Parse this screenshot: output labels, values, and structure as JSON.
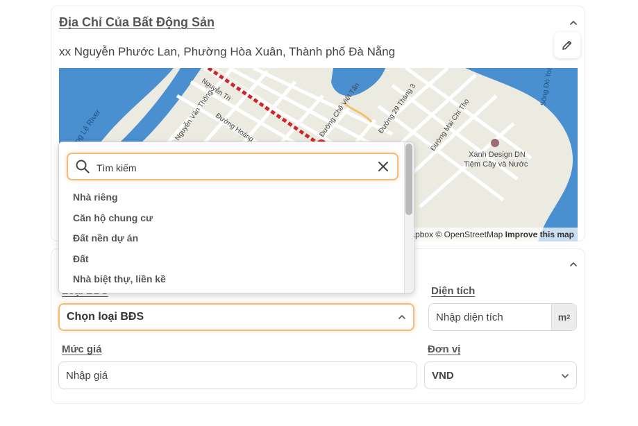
{
  "address_section": {
    "title": "Địa Chỉ Của Bất Động Sản",
    "address": "xx Nguyễn Phước Lan, Phường Hòa Xuân, Thành phố Đà Nẵng"
  },
  "map": {
    "labels": {
      "river_left": "Sông Lệ River",
      "river_right": "Sông Đò Toả",
      "street_1": "Nguyễn Văn Thông",
      "street_2": "Đường Hoàng",
      "street_3": "Nguyễn Tri",
      "street_4": "Đường Chế Viết Tấn",
      "street_5": "Đường 29 Tháng 3",
      "street_6": "Đường Mai Chí Thọ",
      "poi_name": "Xanh Design DN",
      "poi_sub": "Tiệm Cây và Nước"
    },
    "attribution_mapbox": "© Mapbox",
    "attribution_osm": "© OpenStreetMap",
    "attribution_improve": "Improve this map"
  },
  "property_section": {
    "type_label": "Loại BĐS",
    "type_value": "Chọn loại BĐS",
    "area_label": "Diện tích",
    "area_placeholder": "Nhập diện tích",
    "area_unit": "m",
    "area_unit_sup": "2",
    "price_label": "Mức giá",
    "price_placeholder": "Nhập giá",
    "currency_label": "Đơn vị",
    "currency_value": "VND"
  },
  "dropdown": {
    "search_placeholder": "Tìm kiếm",
    "options": [
      "Nhà riêng",
      "Căn hộ chung cư",
      "Đất nền dự án",
      "Đất",
      "Nhà biệt thự, liền kề"
    ]
  },
  "colors": {
    "focus_border": "#f5b97a",
    "water": "#4a8fd0",
    "land": "#ecebe2",
    "road_marker": "#d0252a"
  }
}
